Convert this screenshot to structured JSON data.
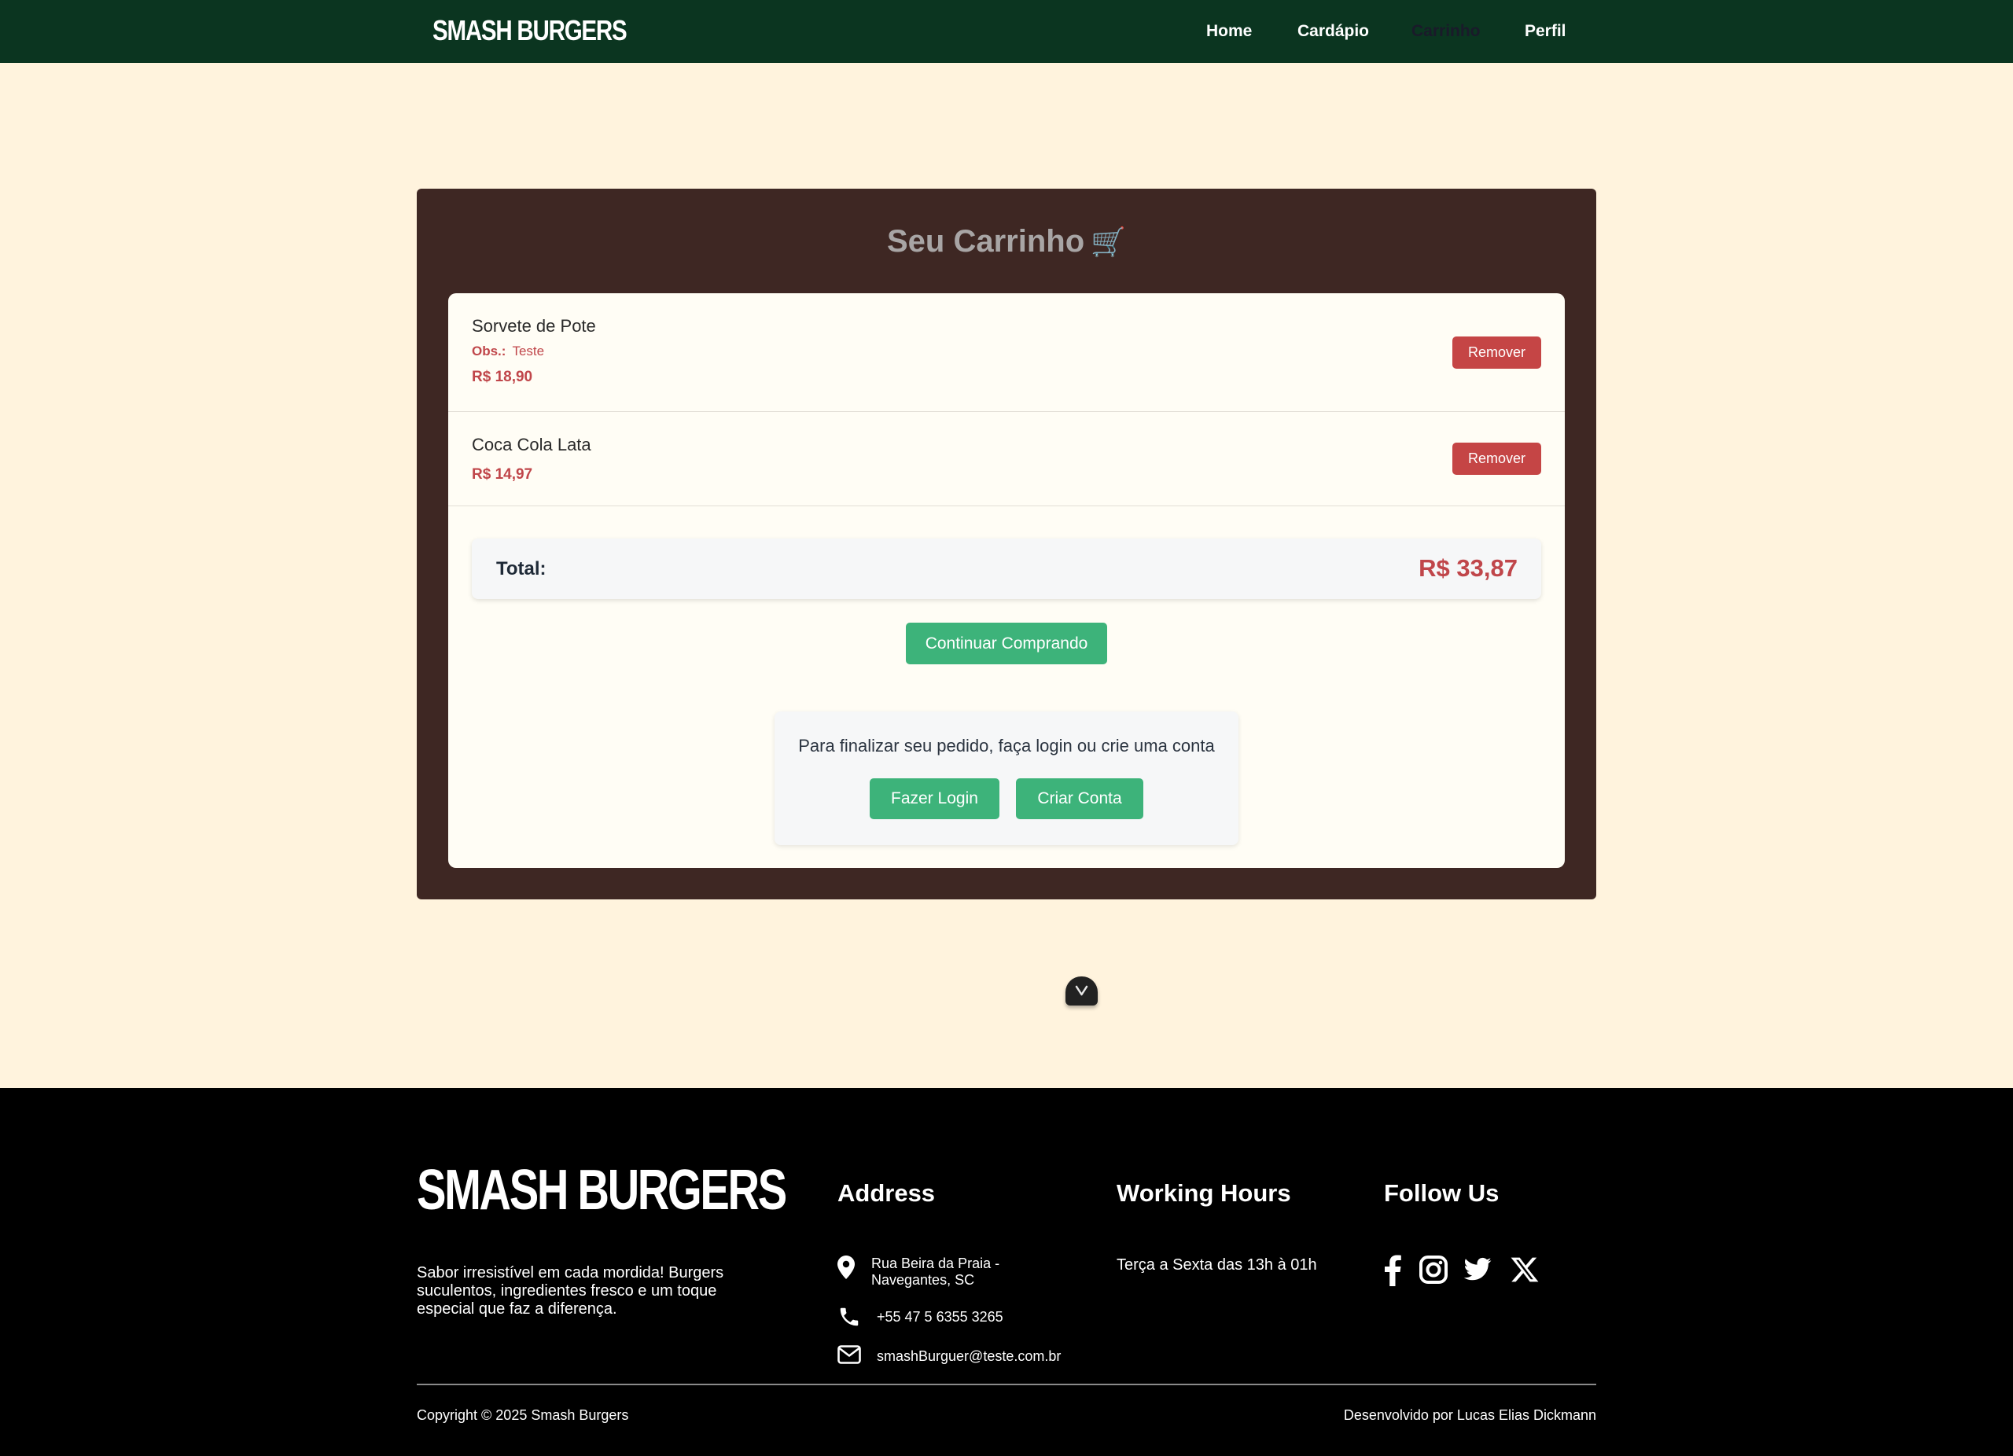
{
  "navbar": {
    "brand": "SMASH BURGERS",
    "links": [
      {
        "label": "Home"
      },
      {
        "label": "Cardápio"
      },
      {
        "label": "Carrinho"
      },
      {
        "label": "Perfil"
      }
    ],
    "active_color": "#1a1a2a",
    "background": "#0b3520"
  },
  "cart": {
    "title": "Seu Carrinho",
    "title_emoji": "🛒",
    "items": [
      {
        "name": "Sorvete de Pote",
        "obs_label": "Obs.:",
        "obs_text": "Teste",
        "price": "R$ 18,90",
        "remove_label": "Remover"
      },
      {
        "name": "Coca Cola Lata",
        "price": "R$ 14,97",
        "remove_label": "Remover"
      }
    ],
    "total_label": "Total:",
    "total_value": "R$ 33,87",
    "continue_label": "Continuar Comprando",
    "login_prompt": "Para finalizar seu pedido, faça login ou crie uma conta",
    "login_label": "Fazer Login",
    "register_label": "Criar Conta",
    "colors": {
      "panel": "#3e2723",
      "accent_red": "#c54545",
      "accent_green": "#3db37a"
    }
  },
  "scroll_toggle_icon": "chevron-down-icon",
  "footer": {
    "brand": "SMASH BURGERS",
    "tagline": "Sabor irresistível em cada mordida! Burgers suculentos, ingredientes fresco e um toque especial que faz a diferença.",
    "address_heading": "Address",
    "address_text": "Rua Beira da Praia - Navegantes, SC",
    "phone": "+55 47 5 6355 3265",
    "email": "smashBurguer@teste.com.br",
    "hours_heading": "Working Hours",
    "hours_text": "Terça a Sexta das 13h à 01h",
    "follow_heading": "Follow Us",
    "social_icons": [
      "facebook-icon",
      "instagram-icon",
      "twitter-icon",
      "x-icon"
    ],
    "copyright": "Copyright © 2025 Smash Burgers",
    "developer": "Desenvolvido por Lucas Elias Dickmann"
  }
}
